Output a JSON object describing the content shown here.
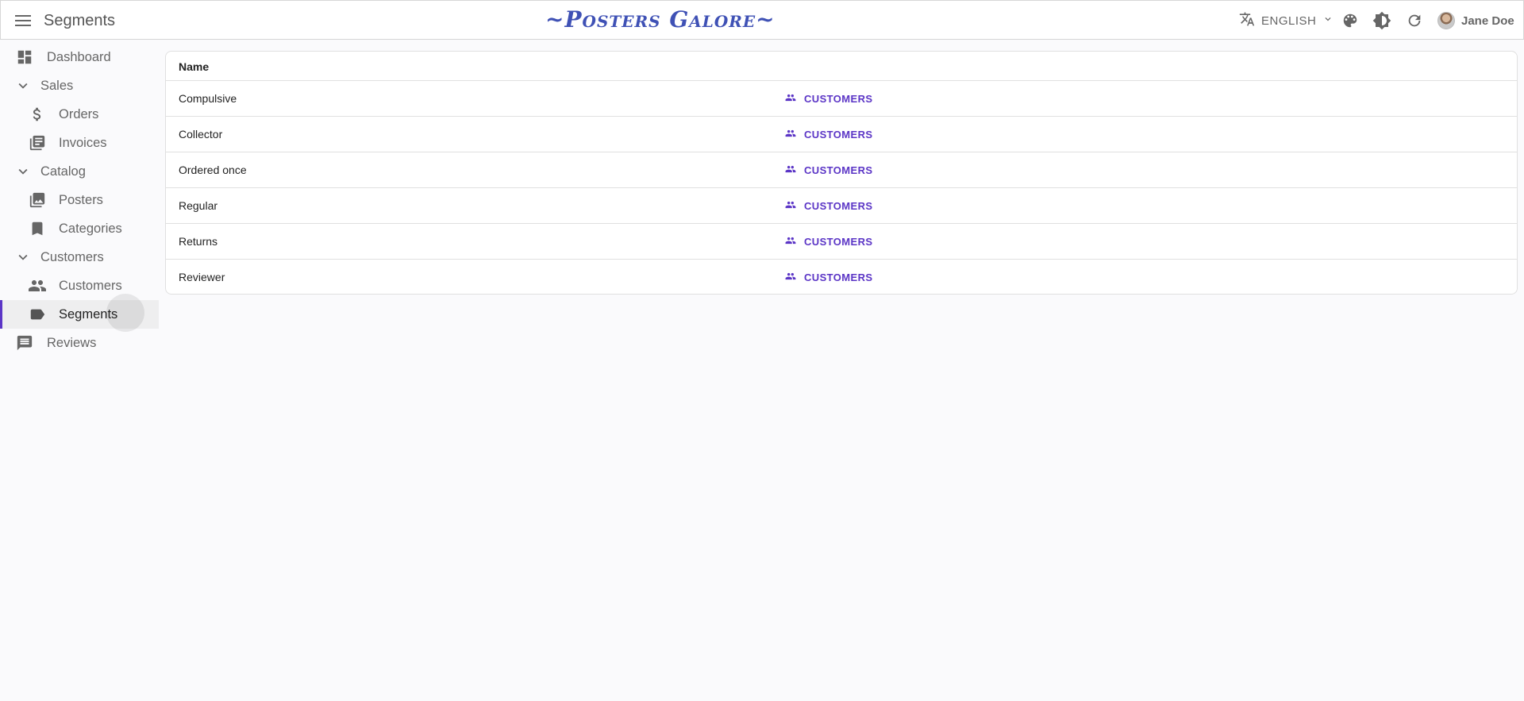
{
  "header": {
    "page_title": "Segments",
    "brand": "~Posters Galore~",
    "language": "ENGLISH",
    "user_name": "Jane Doe"
  },
  "sidebar": {
    "dashboard": "Dashboard",
    "sales": "Sales",
    "orders": "Orders",
    "invoices": "Invoices",
    "catalog": "Catalog",
    "posters": "Posters",
    "categories": "Categories",
    "customers_group": "Customers",
    "customers": "Customers",
    "segments": "Segments",
    "reviews": "Reviews"
  },
  "table": {
    "column_name": "Name",
    "rows": [
      {
        "name": "Compulsive",
        "link": "CUSTOMERS"
      },
      {
        "name": "Collector",
        "link": "CUSTOMERS"
      },
      {
        "name": "Ordered once",
        "link": "CUSTOMERS"
      },
      {
        "name": "Regular",
        "link": "CUSTOMERS"
      },
      {
        "name": "Returns",
        "link": "CUSTOMERS"
      },
      {
        "name": "Reviewer",
        "link": "CUSTOMERS"
      }
    ]
  },
  "colors": {
    "accent": "#5b35c6",
    "brand": "#3f51b5"
  }
}
